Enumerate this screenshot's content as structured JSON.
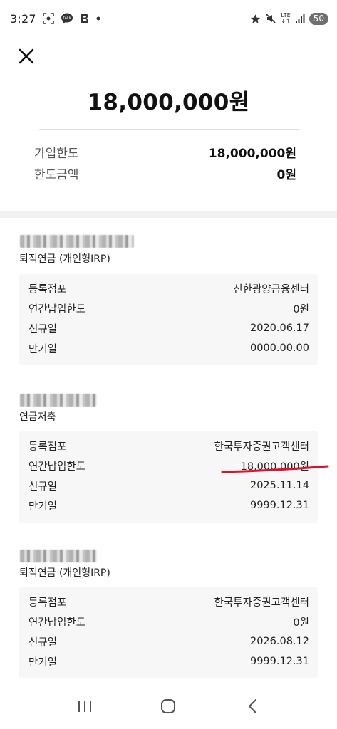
{
  "status_bar": {
    "time": "3:27",
    "notification_icons": [
      "screenshot-icon",
      "talk-icon",
      "b-app-icon",
      "dot-icon"
    ],
    "lte": "LTE",
    "battery": "50"
  },
  "header": {
    "total_amount": "18,000,000원"
  },
  "summary": [
    {
      "label": "가입한도",
      "value": "18,000,000원"
    },
    {
      "label": "한도금액",
      "value": "0원"
    }
  ],
  "accounts": [
    {
      "type": "퇴직연금 (개인형IRP)",
      "rows": [
        {
          "label": "등록점포",
          "value": "신한광양금융센터"
        },
        {
          "label": "연간납입한도",
          "value": "0원"
        },
        {
          "label": "신규일",
          "value": "2020.06.17"
        },
        {
          "label": "만기일",
          "value": "0000.00.00"
        }
      ]
    },
    {
      "type": "연금저축",
      "rows": [
        {
          "label": "등록점포",
          "value": "한국투자증권고객센터"
        },
        {
          "label": "연간납입한도",
          "value": "18,000,000원"
        },
        {
          "label": "신규일",
          "value": "2025.11.14"
        },
        {
          "label": "만기일",
          "value": "9999.12.31"
        }
      ]
    },
    {
      "type": "퇴직연금 (개인형IRP)",
      "rows": [
        {
          "label": "등록점포",
          "value": "한국투자증권고객센터"
        },
        {
          "label": "연간납입한도",
          "value": "0원"
        },
        {
          "label": "신규일",
          "value": "2026.08.12"
        },
        {
          "label": "만기일",
          "value": "9999.12.31"
        }
      ]
    }
  ],
  "colors": {
    "annotation_red": "#e0102a",
    "detail_bg": "#f7f7f7",
    "separator": "#f1f1f1"
  },
  "nav_icons": [
    "recent-apps-icon",
    "home-icon",
    "back-icon"
  ]
}
